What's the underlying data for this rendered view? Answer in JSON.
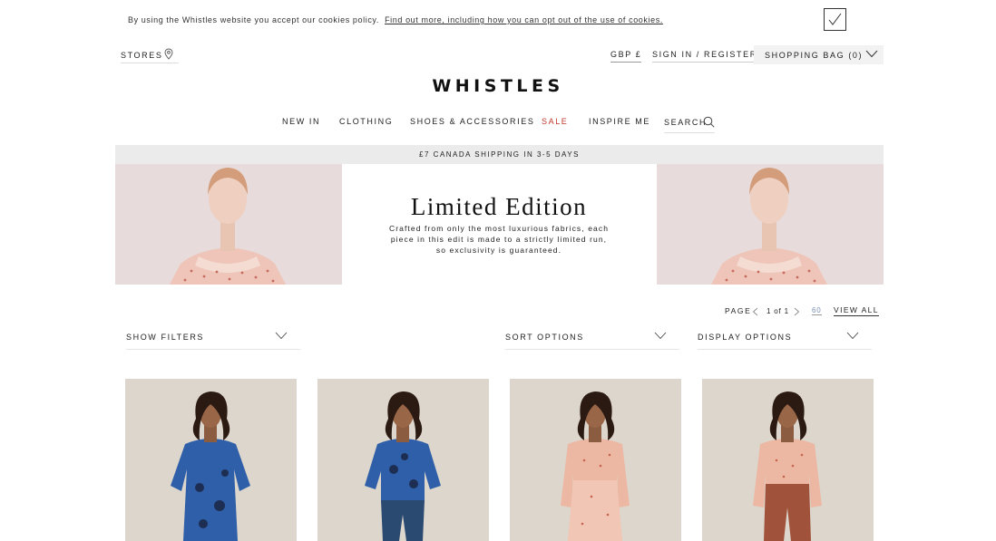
{
  "cookie_bar": {
    "text": "By using the Whistles website you accept our cookies policy.",
    "link": "Find out more, including how you can opt out of the use of cookies."
  },
  "top_bar": {
    "stores": "STORES",
    "currency": "GBP £",
    "sign_in": "SIGN IN / REGISTER",
    "shopping_bag": "SHOPPING BAG (0)"
  },
  "logo": "WHISTLES",
  "nav": {
    "items": [
      "NEW IN",
      "CLOTHING",
      "SHOES & ACCESSORIES",
      "SALE",
      "INSPIRE ME"
    ],
    "search": "SEARCH"
  },
  "shipping_banner": "£7 CANADA SHIPPING IN 3-5 DAYS",
  "hero": {
    "title": "Limited Edition",
    "description": "Crafted from only the most luxurious fabrics, each piece in this edit is made to a strictly limited run, so exclusivity is guaranteed."
  },
  "pagination": {
    "label": "PAGE",
    "count": "1 of 1",
    "per_page": "60",
    "view_all": "VIEW ALL"
  },
  "filters": {
    "show_filters": "SHOW FILTERS",
    "sort_options": "SORT OPTIONS",
    "display_options": "DISPLAY OPTIONS"
  },
  "products": [
    {
      "name": "blue-print-dress"
    },
    {
      "name": "blue-print-top-jeans"
    },
    {
      "name": "pink-floral-blouse-skirt"
    },
    {
      "name": "pink-floral-blouse-trousers"
    }
  ],
  "colors": {
    "sale": "#c0392b",
    "banner_bg": "#ebebeb",
    "bag_bg": "#f2f2f2",
    "per_page_link": "#7a8fb3"
  }
}
